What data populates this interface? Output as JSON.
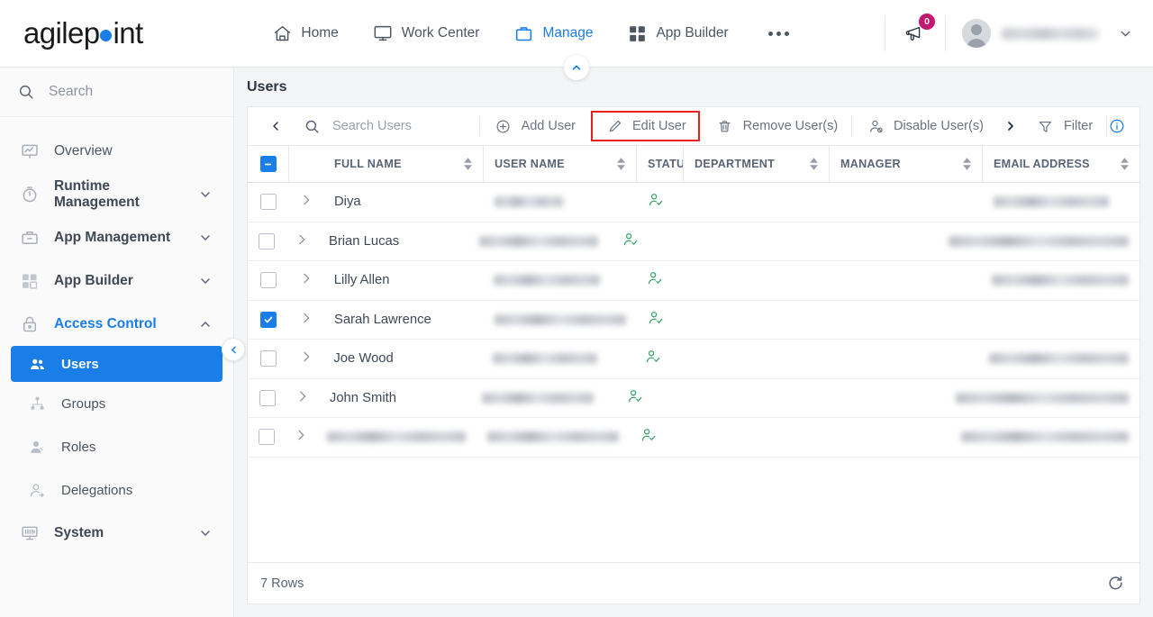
{
  "brand": {
    "name_part1": "agilep",
    "name_part2": "int",
    "dot_color": "#1a7ee8"
  },
  "topnav": {
    "items": [
      {
        "label": "Home",
        "icon": "home-icon",
        "active": false
      },
      {
        "label": "Work Center",
        "icon": "monitor-icon",
        "active": false
      },
      {
        "label": "Manage",
        "icon": "briefcase-icon",
        "active": true
      },
      {
        "label": "App Builder",
        "icon": "grid-icon",
        "active": false
      }
    ],
    "more_label": "more-options-icon",
    "announcement_badge": "0",
    "announcement_icon": "megaphone-icon",
    "user_name": "",
    "user_chevron": "chevron-down-icon"
  },
  "sidebar": {
    "search_placeholder": "Search",
    "search_icon": "search-icon",
    "collapse_icon": "chevron-left-icon",
    "items": [
      {
        "label": "Overview",
        "icon": "overview-icon",
        "type": "item",
        "expandable": false
      },
      {
        "label": "Runtime Management",
        "icon": "timer-icon",
        "type": "group",
        "expandable": true,
        "expanded": false
      },
      {
        "label": "App Management",
        "icon": "toolbox-icon",
        "type": "group",
        "expandable": true,
        "expanded": false
      },
      {
        "label": "App Builder",
        "icon": "appgrid-icon",
        "type": "group",
        "expandable": true,
        "expanded": false
      },
      {
        "label": "Access Control",
        "icon": "lock-icon",
        "type": "group",
        "expandable": true,
        "expanded": true,
        "active": true
      }
    ],
    "sub_items": [
      {
        "label": "Users",
        "icon": "users-icon",
        "selected": true
      },
      {
        "label": "Groups",
        "icon": "groups-icon",
        "selected": false
      },
      {
        "label": "Roles",
        "icon": "roles-icon",
        "selected": false
      },
      {
        "label": "Delegations",
        "icon": "delegations-icon",
        "selected": false
      }
    ],
    "footer_items": [
      {
        "label": "System",
        "icon": "system-icon",
        "type": "group",
        "expandable": true,
        "expanded": false
      }
    ]
  },
  "main": {
    "page_title": "Users",
    "top_collapse_icon": "chevron-up-icon",
    "toolbar": {
      "back_icon": "chevron-left-icon",
      "search_icon": "search-icon",
      "search_placeholder": "Search Users",
      "buttons": [
        {
          "label": "Add User",
          "icon": "circle-plus-icon",
          "highlighted": false
        },
        {
          "label": "Edit User",
          "icon": "pencil-icon",
          "highlighted": true
        },
        {
          "label": "Remove User(s)",
          "icon": "trash-icon",
          "highlighted": false
        },
        {
          "label": "Disable User(s)",
          "icon": "user-disable-icon",
          "highlighted": false
        }
      ],
      "next_icon": "chevron-right-icon",
      "filter_label": "Filter",
      "filter_icon": "funnel-icon",
      "info_icon": "info-icon"
    },
    "table": {
      "select_all_state": "indeterminate",
      "columns": [
        {
          "key": "full_name",
          "label": "FULL NAME",
          "sortable": true
        },
        {
          "key": "user_name",
          "label": "USER NAME",
          "sortable": true
        },
        {
          "key": "status",
          "label": "STATUS",
          "sortable": false
        },
        {
          "key": "dept",
          "label": "DEPARTMENT",
          "sortable": true
        },
        {
          "key": "manager",
          "label": "MANAGER",
          "sortable": true
        },
        {
          "key": "email",
          "label": "EMAIL ADDRESS",
          "sortable": true
        }
      ],
      "rows": [
        {
          "full_name": "Diya",
          "full_name_redacted": false,
          "user_name_redacted": true,
          "status_icon": "user-active-icon",
          "dept": "",
          "manager": "",
          "email_redacted": true,
          "email_width": 128,
          "selected": false
        },
        {
          "full_name": "Brian Lucas",
          "full_name_redacted": false,
          "user_name_redacted": true,
          "status_icon": "user-active-icon",
          "dept": "",
          "manager": "",
          "email_redacted": true,
          "email_width": 200,
          "selected": false
        },
        {
          "full_name": "Lilly Allen",
          "full_name_redacted": false,
          "user_name_redacted": true,
          "status_icon": "user-active-icon",
          "dept": "",
          "manager": "",
          "email_redacted": true,
          "email_width": 152,
          "selected": false
        },
        {
          "full_name": "Sarah Lawrence",
          "full_name_redacted": false,
          "user_name_redacted": true,
          "status_icon": "user-active-icon",
          "dept": "",
          "manager": "",
          "email_redacted": false,
          "email_width": 0,
          "selected": true
        },
        {
          "full_name": "Joe Wood",
          "full_name_redacted": false,
          "user_name_redacted": true,
          "status_icon": "user-active-icon",
          "dept": "",
          "manager": "",
          "email_redacted": true,
          "email_width": 155,
          "selected": false
        },
        {
          "full_name": "John Smith",
          "full_name_redacted": false,
          "user_name_redacted": true,
          "status_icon": "user-active-icon",
          "dept": "",
          "manager": "",
          "email_redacted": true,
          "email_width": 192,
          "selected": false
        },
        {
          "full_name": "",
          "full_name_redacted": true,
          "user_name_redacted": true,
          "status_icon": "user-active-icon",
          "dept": "",
          "manager": "",
          "email_redacted": true,
          "email_width": 186,
          "selected": false
        }
      ],
      "expand_icon": "chevron-right-icon"
    },
    "status_bar": {
      "row_count_label": "7 Rows",
      "refresh_icon": "refresh-icon"
    }
  },
  "colors": {
    "accent_blue": "#1a7ee8",
    "highlight_red": "#e8211f",
    "status_green": "#3aa568",
    "badge_magenta": "#c2186f"
  }
}
